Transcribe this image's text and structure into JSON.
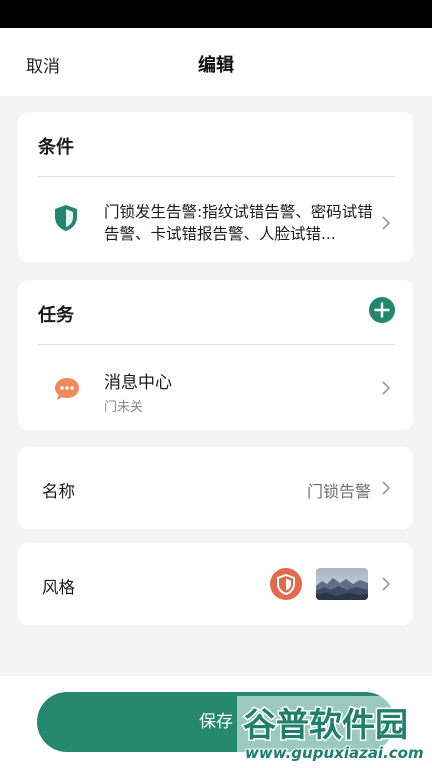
{
  "nav": {
    "cancel_label": "取消",
    "title": "编辑"
  },
  "condition": {
    "title": "条件",
    "icon": "shield-icon",
    "text": "门锁发生告警:指纹试错告警、密码试错告警、卡试错报告警、人脸试错..."
  },
  "task": {
    "title": "任务",
    "add_icon": "plus-icon",
    "item_icon": "chat-bubble-icon",
    "item_name": "消息中心",
    "item_sub": "门未关"
  },
  "name_row": {
    "label": "名称",
    "value": "门锁告警"
  },
  "style_row": {
    "label": "风格",
    "icon": "shield-icon",
    "thumbnail": "landscape-thumbnail"
  },
  "save_label": "保存",
  "watermark": {
    "brand": "谷普软件园",
    "url": "www.gupuxiazai.com"
  },
  "colors": {
    "accent": "#25886f",
    "style_icon_bg": "#e26b4e",
    "chat_icon": "#f08a5d"
  }
}
